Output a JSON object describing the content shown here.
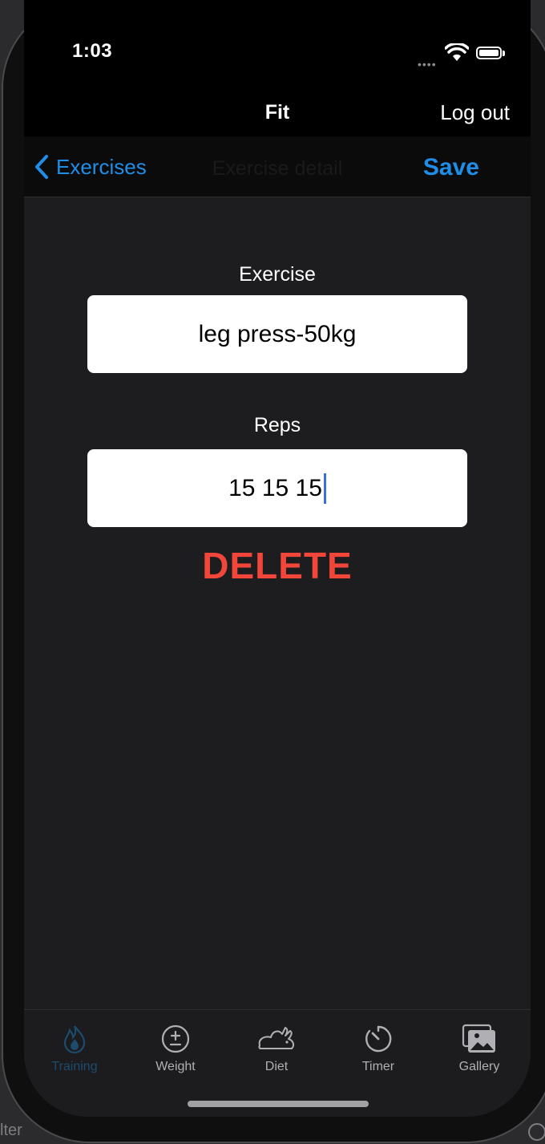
{
  "status_bar": {
    "time": "1:03"
  },
  "header": {
    "title": "Fit",
    "logout_label": "Log out"
  },
  "nav": {
    "back_label": "Exercises",
    "title": "Exercise detail",
    "save_label": "Save"
  },
  "form": {
    "exercise_label": "Exercise",
    "exercise_value": "leg press-50kg",
    "reps_label": "Reps",
    "reps_value": "15 15 15",
    "delete_label": "DELETE"
  },
  "tabs": [
    {
      "label": "Training",
      "icon": "flame-icon",
      "active": true
    },
    {
      "label": "Weight",
      "icon": "plus-minus-icon",
      "active": false
    },
    {
      "label": "Diet",
      "icon": "rabbit-icon",
      "active": false
    },
    {
      "label": "Timer",
      "icon": "timer-icon",
      "active": false
    },
    {
      "label": "Gallery",
      "icon": "photos-icon",
      "active": false
    }
  ],
  "background": {
    "filter_text": "lter"
  },
  "colors": {
    "accent": "#1f8ee8",
    "delete": "#f2463a",
    "caret": "#3b6fe0"
  }
}
